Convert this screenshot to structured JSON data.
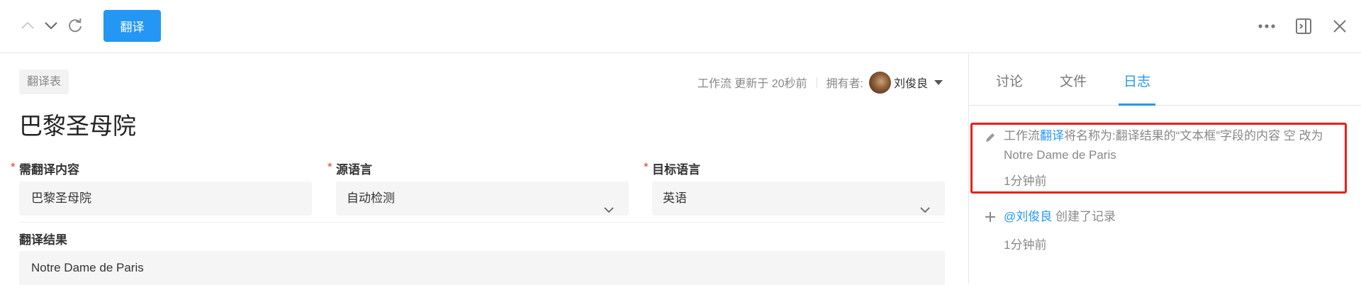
{
  "toolbar": {
    "translate_label": "翻译",
    "icons": {
      "prev": "chevron-up-icon",
      "next": "chevron-down-icon",
      "refresh": "refresh-icon",
      "more": "more-dots-icon",
      "collapse": "panel-collapse-icon",
      "close": "close-icon"
    }
  },
  "form": {
    "tag": "翻译表",
    "title": "巴黎圣母院",
    "meta": {
      "workflow_updated": "工作流 更新于 20秒前",
      "owner_label": "拥有者:",
      "owner_name": "刘俊良"
    },
    "fields": {
      "source_text": {
        "label": "需翻译内容",
        "required": true,
        "value": "巴黎圣母院"
      },
      "source_lang": {
        "label": "源语言",
        "required": true,
        "value": "自动检测"
      },
      "target_lang": {
        "label": "目标语言",
        "required": true,
        "value": "英语"
      },
      "result": {
        "label": "翻译结果",
        "required": false,
        "value": "Notre Dame de Paris"
      }
    },
    "required_mark": "*"
  },
  "panel": {
    "tabs": [
      {
        "label": "讨论"
      },
      {
        "label": "文件"
      },
      {
        "label": "日志",
        "active": true
      }
    ],
    "logs": [
      {
        "icon": "pencil-icon",
        "prefix": "工作流",
        "link": "翻译",
        "text_line1": "将名称为:翻译结果的“文本框”字段的内容 空 改为",
        "text_line2": "Notre Dame de Paris",
        "time": "1分钟前",
        "highlighted": true
      },
      {
        "icon": "plus-icon",
        "link": "@刘俊良",
        "text": " 创建了记录",
        "time": "1分钟前"
      }
    ]
  },
  "colors": {
    "accent": "#2397f3",
    "required": "#e53935",
    "highlight_border": "#e8201c"
  }
}
